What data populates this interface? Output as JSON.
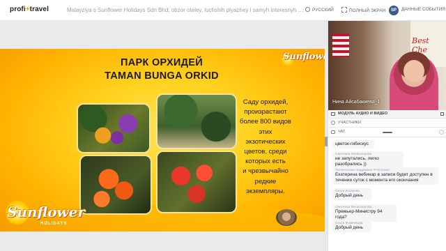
{
  "topbar": {
    "logo": "profi",
    "logo_plus": "+",
    "logo_tail": "travel",
    "title": "Malayziya s Sunflower Holidays Sdn Bhd: obzor oteley, luchshih plyazhey i samyh interesnyh do...",
    "language": "РУССКИЙ",
    "fullscreen": "ПОЛНЫЙ ЭКРАН",
    "avatar_initials": "SP",
    "account": "ДАННЫЕ СОБЫТИЯ"
  },
  "slide": {
    "title_line1": "ПАРК ОРХИДЕЙ",
    "title_line2": "TAMAN BUNGA ORKID",
    "text_lines": [
      "Саду орхидей,",
      "произрастают",
      "более 800 видов",
      "этих",
      "экзотических",
      "цветов, среди",
      "которых есть",
      "и чрезвычайно",
      "редкие",
      "экземпляры."
    ],
    "brand_top": "Sunflower",
    "brand_bottom": "Sunflower",
    "brand_sub": "HOLIDAYS"
  },
  "panel": {
    "video_name": "Нина Айсабакиева_1",
    "poster_text": "Best Che",
    "module_label": "МОДУЛЬ АУДИО И ВИДЕО",
    "participants_label": "УЧАСТНИКИ",
    "chat_label": "ЧАТ",
    "messages": [
      {
        "author": "",
        "text": "цветок-гибискус"
      },
      {
        "author": "Светлана Мелкозерова",
        "text": "не запутались, легко разобрались ))"
      },
      {
        "author": "Техническая поддержка Profi.travel",
        "text": "Екатерина вебинар в записи будет доступен в течении суток с момента его окончания"
      },
      {
        "author": "Ольга Козакова",
        "text": "Добрый день"
      },
      {
        "author": "Светлана Мелкозерова",
        "text": "Премьер-Министру 94 года?"
      },
      {
        "author": "Ольга Фоменкова",
        "text": "Добрый день"
      }
    ]
  },
  "colors": {
    "slide_yellow": "#ffd21f",
    "slide_orange": "#f59800",
    "accent_blue": "#3a5a8c"
  },
  "icons": [
    "globe-icon",
    "fullscreen-icon",
    "camera-icon",
    "close-icon",
    "participants-icon",
    "chat-icon",
    "settings-icon"
  ]
}
